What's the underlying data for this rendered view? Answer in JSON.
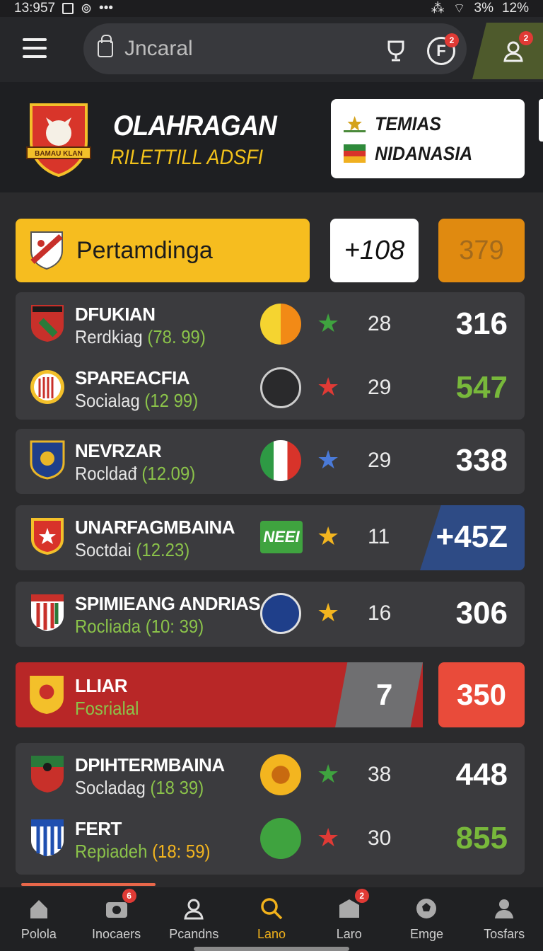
{
  "status": {
    "time": "13:957",
    "battery1": "3%",
    "battery2": "12%"
  },
  "search": {
    "placeholder": "Jncaral",
    "badge_f": "2",
    "badge_profile": "2"
  },
  "hero": {
    "title": "OLAHRAGAN",
    "subtitle": "RILETTILL ADSFI",
    "logo_text": "BAMAU KLAN",
    "lang_1": "TEMIAS",
    "lang_2": "NIDANASIA"
  },
  "category": {
    "label": "Pertamdinga",
    "count": "+108",
    "alt": "379"
  },
  "matches": [
    {
      "name": "DFUKIAN",
      "sub": "Rerdkiag",
      "odds": "(78. 99)",
      "minute": "28",
      "score": "316",
      "star": "green",
      "score_color": "white"
    },
    {
      "name": "SPAREACFIA",
      "sub": "Socialag",
      "odds": "(12 99)",
      "minute": "29",
      "score": "547",
      "star": "red",
      "score_color": "green"
    },
    {
      "name": "NEVRZAR",
      "sub": "Rocldađ",
      "odds": "(12.09)",
      "minute": "29",
      "score": "338",
      "star": "blue",
      "score_color": "white"
    },
    {
      "name": "UNARFAGMBAINA",
      "sub": "Soctdai",
      "odds": "(12.23)",
      "minute": "11",
      "score": "+45Z",
      "star": "yellow",
      "score_color": "white",
      "ball_label": "NEEI"
    },
    {
      "name": "SPIMIEANG ANDRIAS",
      "sub": "Rocliada",
      "odds": "(10: 39)",
      "minute": "16",
      "score": "306",
      "star": "yellow",
      "score_color": "white"
    },
    {
      "name": "DPIHTERMBAINA",
      "sub": "Socladag",
      "odds": "(18 39)",
      "minute": "38",
      "score": "448",
      "star": "green",
      "score_color": "white"
    },
    {
      "name": "FERT",
      "sub": "Repiadeh",
      "odds": "(18: 59)",
      "minute": "30",
      "score": "855",
      "star": "red",
      "score_color": "green"
    }
  ],
  "live": {
    "name": "LLIAR",
    "sub": "Fosrialal",
    "minute": "7",
    "score": "350"
  },
  "bottom_nav": [
    {
      "label": "Polola"
    },
    {
      "label": "Inocaers",
      "badge": "6"
    },
    {
      "label": "Pcandns"
    },
    {
      "label": "Lano"
    },
    {
      "label": "Laro",
      "badge": "2"
    },
    {
      "label": "Emge"
    },
    {
      "label": "Tosfars"
    }
  ],
  "colors": {
    "accent": "#f6bd1f",
    "live": "#b82727",
    "live_score": "#e94b3a",
    "green": "#78b83b",
    "orange": "#e08a10"
  }
}
